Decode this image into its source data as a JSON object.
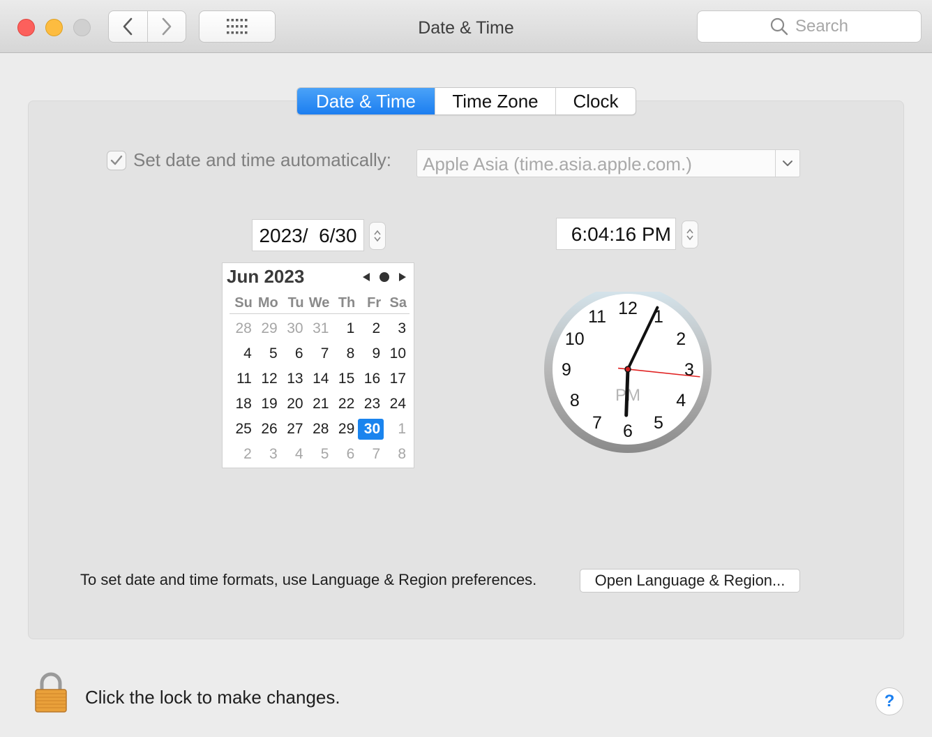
{
  "window": {
    "title": "Date & Time"
  },
  "toolbar": {
    "back_icon": "chevron-left-icon",
    "forward_icon": "chevron-right-icon",
    "grid_icon": "grid-icon",
    "search_placeholder": "Search"
  },
  "tabs": [
    {
      "label": "Date & Time",
      "active": true
    },
    {
      "label": "Time Zone",
      "active": false
    },
    {
      "label": "Clock",
      "active": false
    }
  ],
  "auto": {
    "checked": true,
    "label": "Set date and time automatically:",
    "server": "Apple Asia (time.asia.apple.com.)"
  },
  "date_field": "2023/  6/30",
  "time_field": "6:04:16 PM",
  "calendar": {
    "month_label": "Jun 2023",
    "days_of_week": [
      "Su",
      "Mo",
      "Tu",
      "We",
      "Th",
      "Fr",
      "Sa"
    ],
    "weeks": [
      [
        "28",
        "29",
        "30",
        "31",
        "1",
        "2",
        "3"
      ],
      [
        "4",
        "5",
        "6",
        "7",
        "8",
        "9",
        "10"
      ],
      [
        "11",
        "12",
        "13",
        "14",
        "15",
        "16",
        "17"
      ],
      [
        "18",
        "19",
        "20",
        "21",
        "22",
        "23",
        "24"
      ],
      [
        "25",
        "26",
        "27",
        "28",
        "29",
        "30",
        "1"
      ],
      [
        "2",
        "3",
        "4",
        "5",
        "6",
        "7",
        "8"
      ]
    ],
    "selected_day": "30"
  },
  "clock": {
    "numbers": [
      "12",
      "1",
      "2",
      "3",
      "4",
      "5",
      "6",
      "7",
      "8",
      "9",
      "10",
      "11"
    ],
    "period": "PM",
    "hour": 6,
    "minute": 4,
    "second": 16
  },
  "formats": {
    "text": "To set date and time formats, use Language & Region preferences.",
    "button": "Open Language & Region..."
  },
  "footer": {
    "lock_text": "Click the lock to make changes.",
    "help_label": "?"
  },
  "colors": {
    "accent": "#1a84ee",
    "close": "#fc605c",
    "minimize": "#fdbc40",
    "zoom": "#d0d0d0",
    "second_hand": "#e02020"
  }
}
